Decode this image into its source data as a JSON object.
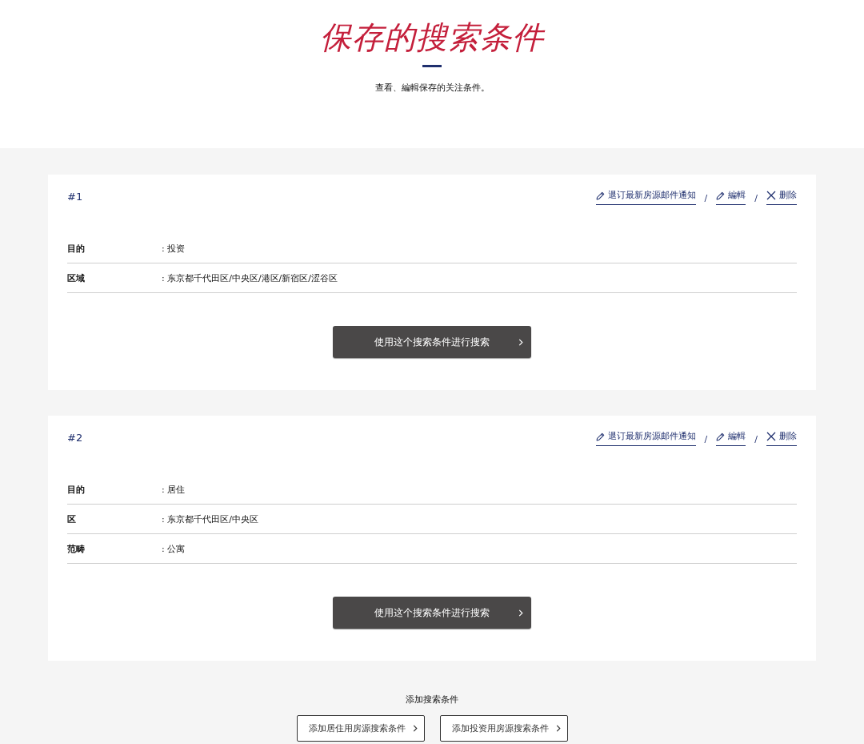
{
  "page": {
    "title": "保存的搜索条件",
    "subtitle": "查看、編輯保存的关注条件。"
  },
  "saved_searches": [
    {
      "number": "#1",
      "actions": [
        {
          "kind": "unsubscribe",
          "label": "退订最新房源邮件通知"
        },
        {
          "kind": "edit",
          "separator": "/",
          "label": "編輯"
        },
        {
          "kind": "delete",
          "separator": "/",
          "label": "删除"
        }
      ],
      "criteria": [
        {
          "label": "目的",
          "value": ": 投资"
        },
        {
          "label": "区域",
          "value": ": 东京都千代田区/中央区/港区/新宿区/涩谷区"
        }
      ],
      "search_button": "使用这个搜索条件进行搜索"
    },
    {
      "number": "#2",
      "actions": [
        {
          "kind": "unsubscribe",
          "label": "退订最新房源邮件通知"
        },
        {
          "kind": "edit",
          "separator": "/",
          "label": "編輯"
        },
        {
          "kind": "delete",
          "separator": "/",
          "label": "删除"
        }
      ],
      "criteria": [
        {
          "label": "目的",
          "value": ": 居住"
        },
        {
          "label": "区",
          "value": ": 东京都千代田区/中央区"
        },
        {
          "label": "范畴",
          "value": ": 公寓"
        }
      ],
      "search_button": "使用这个搜索条件进行搜索"
    }
  ],
  "add_section": {
    "heading": "添加搜索条件",
    "buttons": [
      "添加居住用房源搜索条件",
      "添加投资用房源搜索条件"
    ]
  }
}
